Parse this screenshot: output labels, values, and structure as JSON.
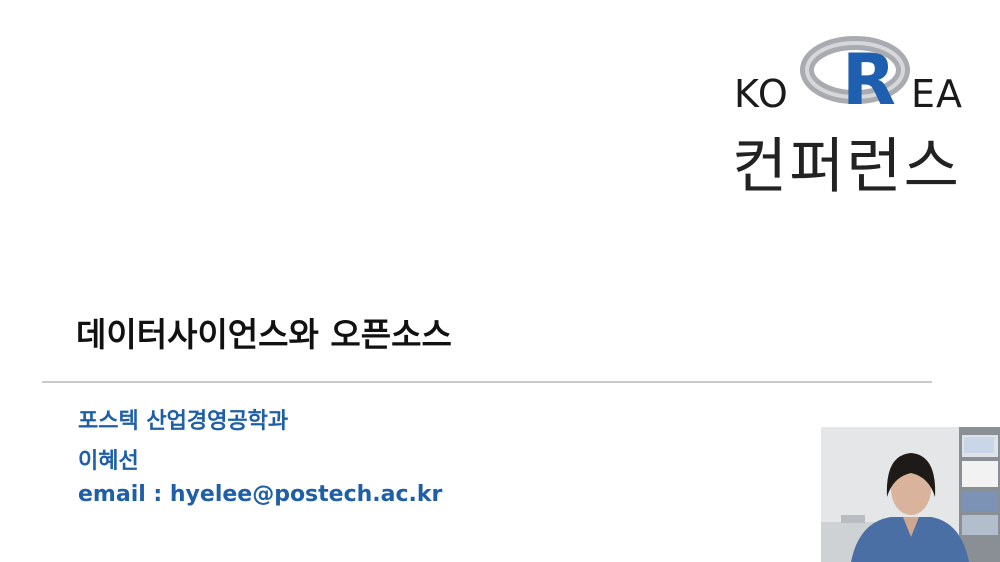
{
  "logo": {
    "left_text": "KO",
    "mark_letter": "R",
    "right_text": "EA",
    "subtitle": "컨퍼런스",
    "colors": {
      "ring": "#a9abb0",
      "letter": "#1f5fb0"
    }
  },
  "slide": {
    "title": "데이터사이언스와 오픈소스",
    "affiliation": "포스텍 산업경영공학과",
    "name": "이혜선",
    "email_line": "email : hyelee@postech.ac.kr"
  },
  "colors": {
    "text_blue": "#1f5fa8",
    "divider": "#c9c9c9"
  }
}
